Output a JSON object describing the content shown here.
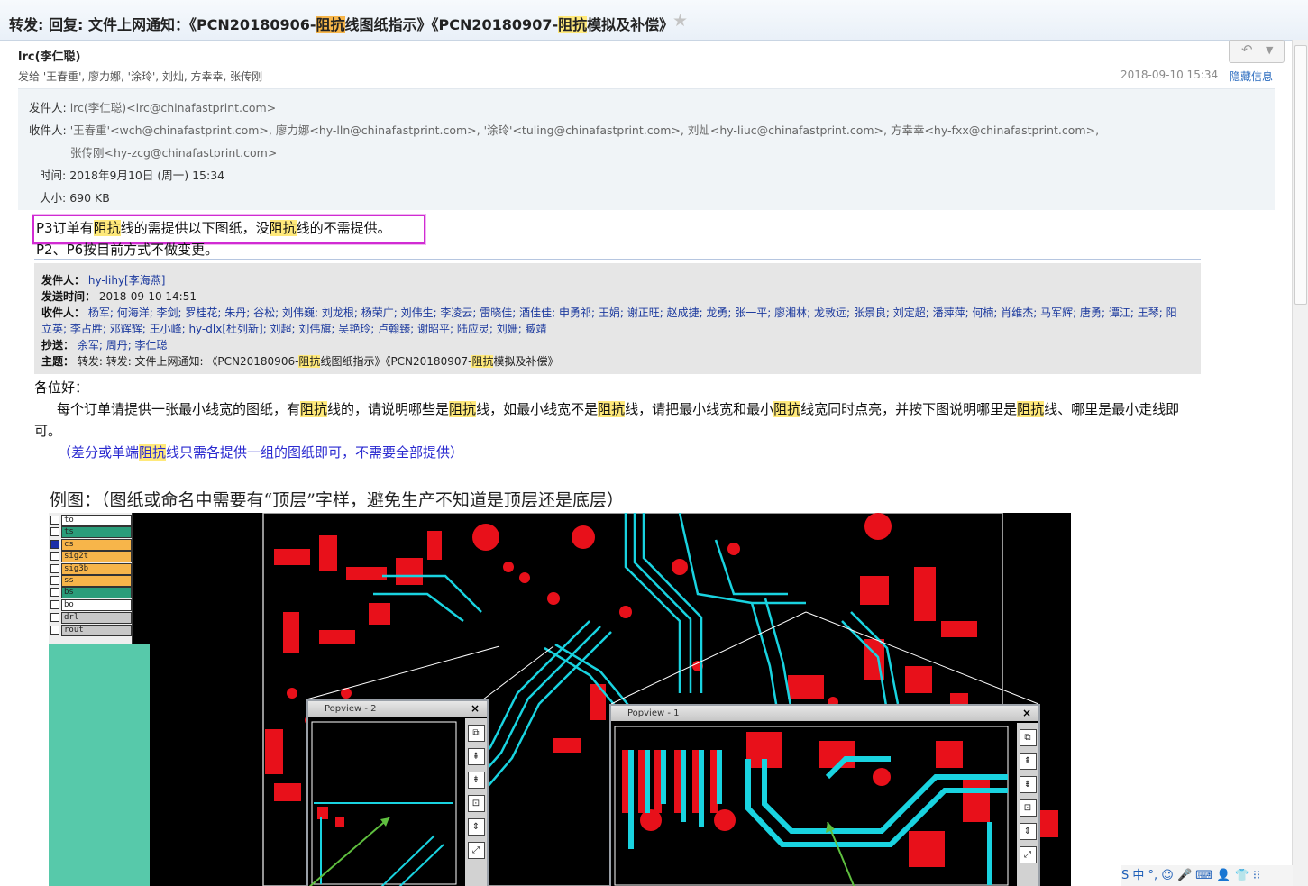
{
  "subject": {
    "before": "转发: 回复: 文件上网通知：《PCN20180906-",
    "hl1": "阻抗",
    "mid": "线图纸指示》《PCN20180907-",
    "hl2": "阻抗",
    "after": "模拟及补偿》",
    "star": "★"
  },
  "header": {
    "sender_name": "lrc(李仁聪)",
    "recipients_summary": "发给 '王春重', 廖力娜, '涂玲', 刘灿, 方幸幸, 张传刚",
    "datetime": "2018-09-10 15:34",
    "hide_info": "隐藏信息",
    "reply_icon": "↶",
    "dropdown_icon": "▼"
  },
  "details": {
    "from_label": "发件人:",
    "from_value": "lrc(李仁聪)<lrc@chinafastprint.com>",
    "to_label": "收件人:",
    "to_value_1": "'王春重'<wch@chinafastprint.com>,  廖力娜<hy-lln@chinafastprint.com>,  '涂玲'<tuling@chinafastprint.com>,  刘灿<hy-liuc@chinafastprint.com>,  方幸幸<hy-fxx@chinafastprint.com>,",
    "to_value_2": "张传刚<hy-zcg@chinafastprint.com>",
    "time_label": "时间:",
    "time_value": "2018年9月10日 (周一) 15:34",
    "size_label": "大小:",
    "size_value": "690 KB"
  },
  "body": {
    "note1_a": "P3订单有",
    "note1_hl1": "阻抗",
    "note1_b": "线的需提供以下图纸，没",
    "note1_hl2": "阻抗",
    "note1_c": "线的不需提供。",
    "note2": "P2、P6按目前方式不做变更。",
    "forward": {
      "from_label": "发件人：",
      "from_value": "hy-lihy[李海燕]",
      "sent_label": "发送时间：",
      "sent_value": "2018-09-10 14:51",
      "to_label": "收件人：",
      "to_value_1": "杨军; 何海洋; 李剑; 罗桂花; 朱丹; 谷松; 刘伟巍; 刘龙根; 杨荣广; 刘伟生; 李凌云; 雷晓佳; 酒佳佳; 申勇祁; 王娟; 谢正旺; 赵成捷; 龙勇; 张一平; 廖湘林; 龙敦远; 张景良; 刘定超; 潘萍萍; 何楠; 肖维杰; 马军辉; 唐勇; 谭江; 王琴; 阳",
      "to_value_2a": "立英; 李占胜; 邓辉辉; 王小峰; ",
      "to_value_2link": "hy-dlx[杜列新]",
      "to_value_2b": "; 刘超; 刘伟旗; 吴艳玲; 卢翰臻; 谢昭平; 陆应灵; 刘姗; 臧靖",
      "cc_label": "抄送：",
      "cc_value": "余军; 周丹; 李仁聪",
      "subject_label": "主题：",
      "subject_a": "转发: 转发: 文件上网通知: 《PCN20180906-",
      "subject_hl1": "阻抗",
      "subject_b": "线图纸指示》《PCN20180907-",
      "subject_hl2": "阻抗",
      "subject_c": "模拟及补偿》"
    },
    "greeting": "各位好：",
    "para": [
      {
        "t": "每个订单请提供一张最小线宽的图纸，有"
      },
      {
        "h": "阻抗"
      },
      {
        "t": "线的，请说明哪些是"
      },
      {
        "h": "阻抗"
      },
      {
        "t": "线，如最小线宽不是"
      },
      {
        "h": "阻抗"
      },
      {
        "t": "线，请把最小线宽和最小"
      },
      {
        "h": "阻抗"
      },
      {
        "t": "线宽同时点亮，并按下图说明哪里是"
      },
      {
        "h": "阻抗"
      },
      {
        "t": "线、哪里是最小走线即可。"
      }
    ],
    "blue_a": "（差分或单端",
    "blue_hl": "阻抗",
    "blue_b": "线只需各提供一组的图纸即可，不需要全部提供）",
    "example": "例图：（图纸或命名中需要有“顶层”字样，避免生产不知道是顶层还是底层）"
  },
  "image": {
    "layers": [
      {
        "name": "to",
        "color": "#ffffff"
      },
      {
        "name": "ts",
        "color": "#2a9d7a"
      },
      {
        "name": "cs",
        "color": "#f7b54a"
      },
      {
        "name": "sig2t",
        "color": "#f7b54a"
      },
      {
        "name": "sig3b",
        "color": "#f7b54a"
      },
      {
        "name": "ss",
        "color": "#f7b54a"
      },
      {
        "name": "bs",
        "color": "#2a9d7a"
      },
      {
        "name": "bo",
        "color": "#ffffff"
      },
      {
        "name": "drl",
        "color": "#c8c8c8"
      },
      {
        "name": "rout",
        "color": "#c8c8c8"
      }
    ],
    "popview2_title": "Popview - 2",
    "popview1_title": "Popview - 1",
    "close_glyph": "×"
  },
  "tray": {
    "text": "S 中 °, ☺ 🎤 ⌨ 👤 👕 ⁝⁝"
  },
  "colors": {
    "highlight": "#ffe97a",
    "highlight_strong": "#f6b54a",
    "note_border": "#d12bd3",
    "link": "#1c3a9e",
    "pcb_red": "#e8101a",
    "pcb_cyan": "#19d3e0"
  }
}
